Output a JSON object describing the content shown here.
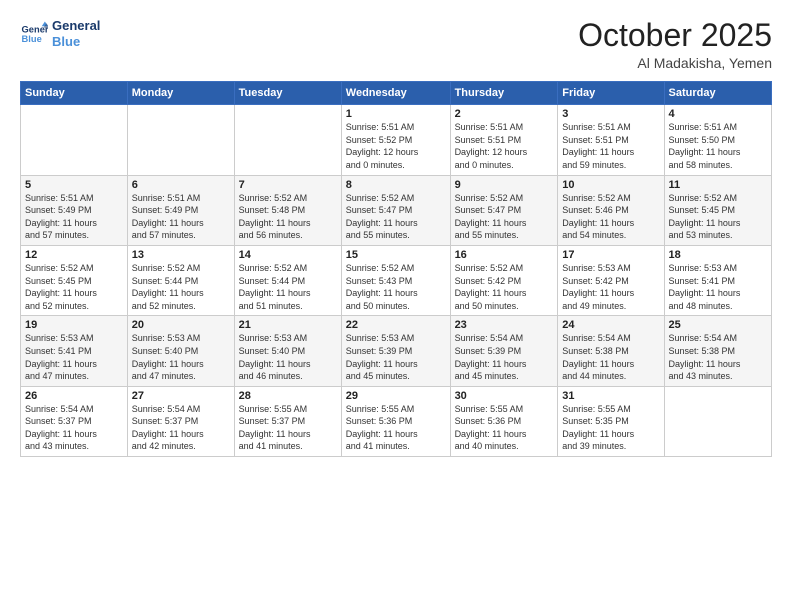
{
  "logo": {
    "line1": "General",
    "line2": "Blue"
  },
  "title": "October 2025",
  "location": "Al Madakisha, Yemen",
  "days_header": [
    "Sunday",
    "Monday",
    "Tuesday",
    "Wednesday",
    "Thursday",
    "Friday",
    "Saturday"
  ],
  "weeks": [
    [
      {
        "day": "",
        "info": ""
      },
      {
        "day": "",
        "info": ""
      },
      {
        "day": "",
        "info": ""
      },
      {
        "day": "1",
        "info": "Sunrise: 5:51 AM\nSunset: 5:52 PM\nDaylight: 12 hours\nand 0 minutes."
      },
      {
        "day": "2",
        "info": "Sunrise: 5:51 AM\nSunset: 5:51 PM\nDaylight: 12 hours\nand 0 minutes."
      },
      {
        "day": "3",
        "info": "Sunrise: 5:51 AM\nSunset: 5:51 PM\nDaylight: 11 hours\nand 59 minutes."
      },
      {
        "day": "4",
        "info": "Sunrise: 5:51 AM\nSunset: 5:50 PM\nDaylight: 11 hours\nand 58 minutes."
      }
    ],
    [
      {
        "day": "5",
        "info": "Sunrise: 5:51 AM\nSunset: 5:49 PM\nDaylight: 11 hours\nand 57 minutes."
      },
      {
        "day": "6",
        "info": "Sunrise: 5:51 AM\nSunset: 5:49 PM\nDaylight: 11 hours\nand 57 minutes."
      },
      {
        "day": "7",
        "info": "Sunrise: 5:52 AM\nSunset: 5:48 PM\nDaylight: 11 hours\nand 56 minutes."
      },
      {
        "day": "8",
        "info": "Sunrise: 5:52 AM\nSunset: 5:47 PM\nDaylight: 11 hours\nand 55 minutes."
      },
      {
        "day": "9",
        "info": "Sunrise: 5:52 AM\nSunset: 5:47 PM\nDaylight: 11 hours\nand 55 minutes."
      },
      {
        "day": "10",
        "info": "Sunrise: 5:52 AM\nSunset: 5:46 PM\nDaylight: 11 hours\nand 54 minutes."
      },
      {
        "day": "11",
        "info": "Sunrise: 5:52 AM\nSunset: 5:45 PM\nDaylight: 11 hours\nand 53 minutes."
      }
    ],
    [
      {
        "day": "12",
        "info": "Sunrise: 5:52 AM\nSunset: 5:45 PM\nDaylight: 11 hours\nand 52 minutes."
      },
      {
        "day": "13",
        "info": "Sunrise: 5:52 AM\nSunset: 5:44 PM\nDaylight: 11 hours\nand 52 minutes."
      },
      {
        "day": "14",
        "info": "Sunrise: 5:52 AM\nSunset: 5:44 PM\nDaylight: 11 hours\nand 51 minutes."
      },
      {
        "day": "15",
        "info": "Sunrise: 5:52 AM\nSunset: 5:43 PM\nDaylight: 11 hours\nand 50 minutes."
      },
      {
        "day": "16",
        "info": "Sunrise: 5:52 AM\nSunset: 5:42 PM\nDaylight: 11 hours\nand 50 minutes."
      },
      {
        "day": "17",
        "info": "Sunrise: 5:53 AM\nSunset: 5:42 PM\nDaylight: 11 hours\nand 49 minutes."
      },
      {
        "day": "18",
        "info": "Sunrise: 5:53 AM\nSunset: 5:41 PM\nDaylight: 11 hours\nand 48 minutes."
      }
    ],
    [
      {
        "day": "19",
        "info": "Sunrise: 5:53 AM\nSunset: 5:41 PM\nDaylight: 11 hours\nand 47 minutes."
      },
      {
        "day": "20",
        "info": "Sunrise: 5:53 AM\nSunset: 5:40 PM\nDaylight: 11 hours\nand 47 minutes."
      },
      {
        "day": "21",
        "info": "Sunrise: 5:53 AM\nSunset: 5:40 PM\nDaylight: 11 hours\nand 46 minutes."
      },
      {
        "day": "22",
        "info": "Sunrise: 5:53 AM\nSunset: 5:39 PM\nDaylight: 11 hours\nand 45 minutes."
      },
      {
        "day": "23",
        "info": "Sunrise: 5:54 AM\nSunset: 5:39 PM\nDaylight: 11 hours\nand 45 minutes."
      },
      {
        "day": "24",
        "info": "Sunrise: 5:54 AM\nSunset: 5:38 PM\nDaylight: 11 hours\nand 44 minutes."
      },
      {
        "day": "25",
        "info": "Sunrise: 5:54 AM\nSunset: 5:38 PM\nDaylight: 11 hours\nand 43 minutes."
      }
    ],
    [
      {
        "day": "26",
        "info": "Sunrise: 5:54 AM\nSunset: 5:37 PM\nDaylight: 11 hours\nand 43 minutes."
      },
      {
        "day": "27",
        "info": "Sunrise: 5:54 AM\nSunset: 5:37 PM\nDaylight: 11 hours\nand 42 minutes."
      },
      {
        "day": "28",
        "info": "Sunrise: 5:55 AM\nSunset: 5:37 PM\nDaylight: 11 hours\nand 41 minutes."
      },
      {
        "day": "29",
        "info": "Sunrise: 5:55 AM\nSunset: 5:36 PM\nDaylight: 11 hours\nand 41 minutes."
      },
      {
        "day": "30",
        "info": "Sunrise: 5:55 AM\nSunset: 5:36 PM\nDaylight: 11 hours\nand 40 minutes."
      },
      {
        "day": "31",
        "info": "Sunrise: 5:55 AM\nSunset: 5:35 PM\nDaylight: 11 hours\nand 39 minutes."
      },
      {
        "day": "",
        "info": ""
      }
    ]
  ]
}
